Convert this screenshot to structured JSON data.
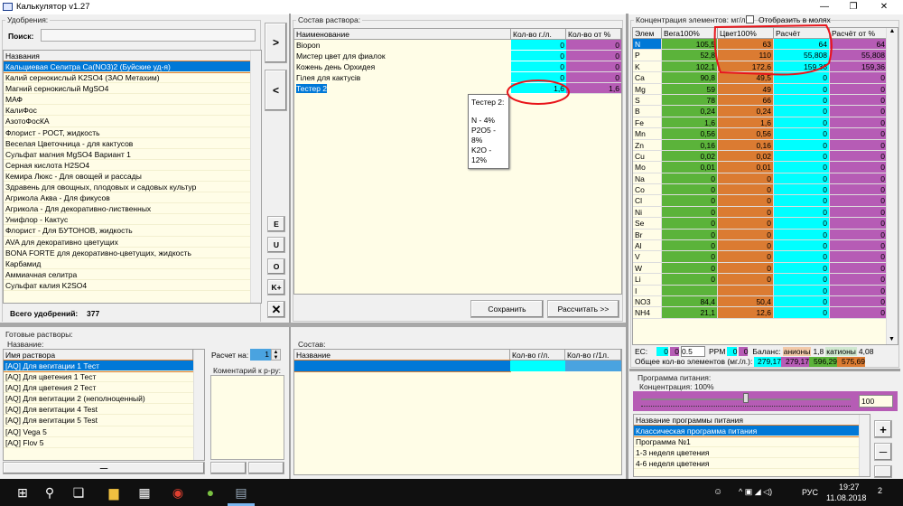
{
  "window": {
    "title": "Калькулятор v1.27",
    "controls": [
      "—",
      "❐",
      "✕"
    ]
  },
  "fertilizers": {
    "group_label": "Удобрения:",
    "search_label": "Поиск:",
    "search_value": "",
    "column": "Названия",
    "items": [
      "Кальциевая Селитра Ca(NO3)2 (Буйские уд-я)",
      "Калий  сернокислый  K2SO4 (ЗАО Метахим)",
      "Магний сернокислый MgSO4",
      "МАФ",
      "КалиФос",
      "АзотоФосКА",
      "Флорист - РОСТ, жидкость",
      "Веселая Цветочница - для кактусов",
      "Сульфат магния MgSO4 Вариант 1",
      "Серная кислота H2SO4",
      "Кемира Люкс - Для овощей и рассады",
      "Здравень для овощных, плодовых и садовых культур",
      "Агрикола Аква - Для фикусов",
      "Агрикола - Для декоративно-лиственных",
      "Унифлор - Кактус",
      "Флорист - Для БУТОНОВ, жидкость",
      "AVA для декоративно цветущих",
      "BONA FORTE для декоративно-цветущих, жидкость",
      "Карбамид",
      "Аммиачная селитра",
      "Сульфат калия K2SO4"
    ],
    "total_label": "Всего удобрений:",
    "total_value": "377"
  },
  "side_buttons": {
    "add": ">",
    "remove": "<",
    "e": "E",
    "u": "U",
    "o": "O",
    "k_plus": "K+",
    "delete": "✕"
  },
  "composition": {
    "group_label": "Состав раствора:",
    "columns": [
      "Наименование",
      "Кол-во г./л.",
      "Кол-во от %"
    ],
    "rows": [
      {
        "name": "Biopon",
        "gl": "0",
        "pct": "0"
      },
      {
        "name": "Мистер цвет для фиалок",
        "gl": "0",
        "pct": "0"
      },
      {
        "name": "Кожень день Орхидея",
        "gl": "0",
        "pct": "0"
      },
      {
        "name": "Гілея для кактусів",
        "gl": "0",
        "pct": "0"
      },
      {
        "name": "Тестер 2",
        "gl": "1,6",
        "pct": "1,6"
      }
    ],
    "tooltip": {
      "title": "Тестер 2:",
      "lines": [
        "N - 4%",
        "P2O5 - 8%",
        "K2O - 12%"
      ]
    },
    "save_label": "Сохранить",
    "calc_label": "Рассчитать >>"
  },
  "ready": {
    "group_label": "Готовые растворы:",
    "name_label": "Название:",
    "column": "Имя раствора",
    "items": [
      "[AQ] Для вегитации 1 Тест",
      "[AQ] Для цветения 1 Тест",
      "[AQ] Для цветения 2 Тест",
      "[AQ] Для вегитации 2 (неполноценный)",
      "[AQ] Для вегитации 4 Test",
      "[AQ] Для вегитации 5 Test",
      "[AQ] Vega 5",
      "[AQ] Flov 5"
    ],
    "minus_label": "—",
    "calc_for_label": "Расчет на:",
    "calc_for_value": "1",
    "comment_label": "Коментарий к р-ру:"
  },
  "ready_composition": {
    "group_label": "Состав:",
    "columns": [
      "Название",
      "Кол-во г/л.",
      "Кол-во г/1л."
    ]
  },
  "concentration": {
    "group_label": "Концентрация элементов: мг/л",
    "show_moles_label": "Отобразить в молях",
    "show_moles_checked": false,
    "columns": [
      "Элем",
      "Вега100%",
      "Цвет100%",
      "Расчёт",
      "Расчёт от %"
    ],
    "rows": [
      [
        "N",
        "105,5",
        "63",
        "64",
        "64"
      ],
      [
        "P",
        "52,8",
        "110",
        "55,808",
        "55,808"
      ],
      [
        "K",
        "102,1",
        "172,6",
        "159,36",
        "159,36"
      ],
      [
        "Ca",
        "90,8",
        "49,5",
        "0",
        "0"
      ],
      [
        "Mg",
        "59",
        "49",
        "0",
        "0"
      ],
      [
        "S",
        "78",
        "66",
        "0",
        "0"
      ],
      [
        "B",
        "0,24",
        "0,24",
        "0",
        "0"
      ],
      [
        "Fe",
        "1,6",
        "1,6",
        "0",
        "0"
      ],
      [
        "Mn",
        "0,56",
        "0,56",
        "0",
        "0"
      ],
      [
        "Zn",
        "0,16",
        "0,16",
        "0",
        "0"
      ],
      [
        "Cu",
        "0,02",
        "0,02",
        "0",
        "0"
      ],
      [
        "Mo",
        "0,01",
        "0,01",
        "0",
        "0"
      ],
      [
        "Na",
        "0",
        "0",
        "0",
        "0"
      ],
      [
        "Co",
        "0",
        "0",
        "0",
        "0"
      ],
      [
        "Cl",
        "0",
        "0",
        "0",
        "0"
      ],
      [
        "Ni",
        "0",
        "0",
        "0",
        "0"
      ],
      [
        "Se",
        "0",
        "0",
        "0",
        "0"
      ],
      [
        "Br",
        "0",
        "0",
        "0",
        "0"
      ],
      [
        "Al",
        "0",
        "0",
        "0",
        "0"
      ],
      [
        "V",
        "0",
        "0",
        "0",
        "0"
      ],
      [
        "W",
        "0",
        "0",
        "0",
        "0"
      ],
      [
        "Li",
        "0",
        "0",
        "0",
        "0"
      ],
      [
        "I",
        "",
        "",
        "0",
        "0"
      ],
      [
        "NO3",
        "84,4",
        "50,4",
        "0",
        "0"
      ],
      [
        "NH4",
        "21,1",
        "12,6",
        "0",
        "0"
      ]
    ],
    "ec_label": "EC:",
    "ec_values": [
      "0",
      "0"
    ],
    "ec_step": "0.5",
    "ppm_label": "PPM",
    "ppm_values": [
      "0",
      "0"
    ],
    "balance_label": "Баланс:",
    "anions_label": "анионы",
    "anions_value": "1,8",
    "cations_label": "катионы",
    "cations_value": "4,08",
    "total_label": "Общее кол-во элементов (мг./л.):",
    "totals": [
      "279,17",
      "279,17",
      "596,29",
      "575,69"
    ]
  },
  "program": {
    "group_label": "Программа питания:",
    "conc_label": "Концентрация: 100%",
    "slider_percent": 100,
    "conc_value": "100",
    "column": "Название программы питания",
    "items": [
      "Классическая программа питания",
      "Программа №1",
      "1-3 неделя цветения",
      "4-6 неделя цветения"
    ],
    "plus": "+",
    "minus": "—"
  },
  "colors": {
    "green": "#5bb33a",
    "orange": "#db7b32",
    "cyan": "#00ffff",
    "purple": "#b65cb5",
    "selection": "#0078d7",
    "list_bg": "#fffde7",
    "annotation": "#e8141a"
  },
  "taskbar": {
    "time": "19:27",
    "date": "11.08.2018",
    "lang": "РУС",
    "notifications": "2",
    "icons": [
      "windows-start-icon",
      "search-icon",
      "task-view-icon",
      "file-explorer-icon",
      "calculator-icon",
      "chrome-icon",
      "utorrent-icon",
      "calculator-app-icon"
    ]
  }
}
